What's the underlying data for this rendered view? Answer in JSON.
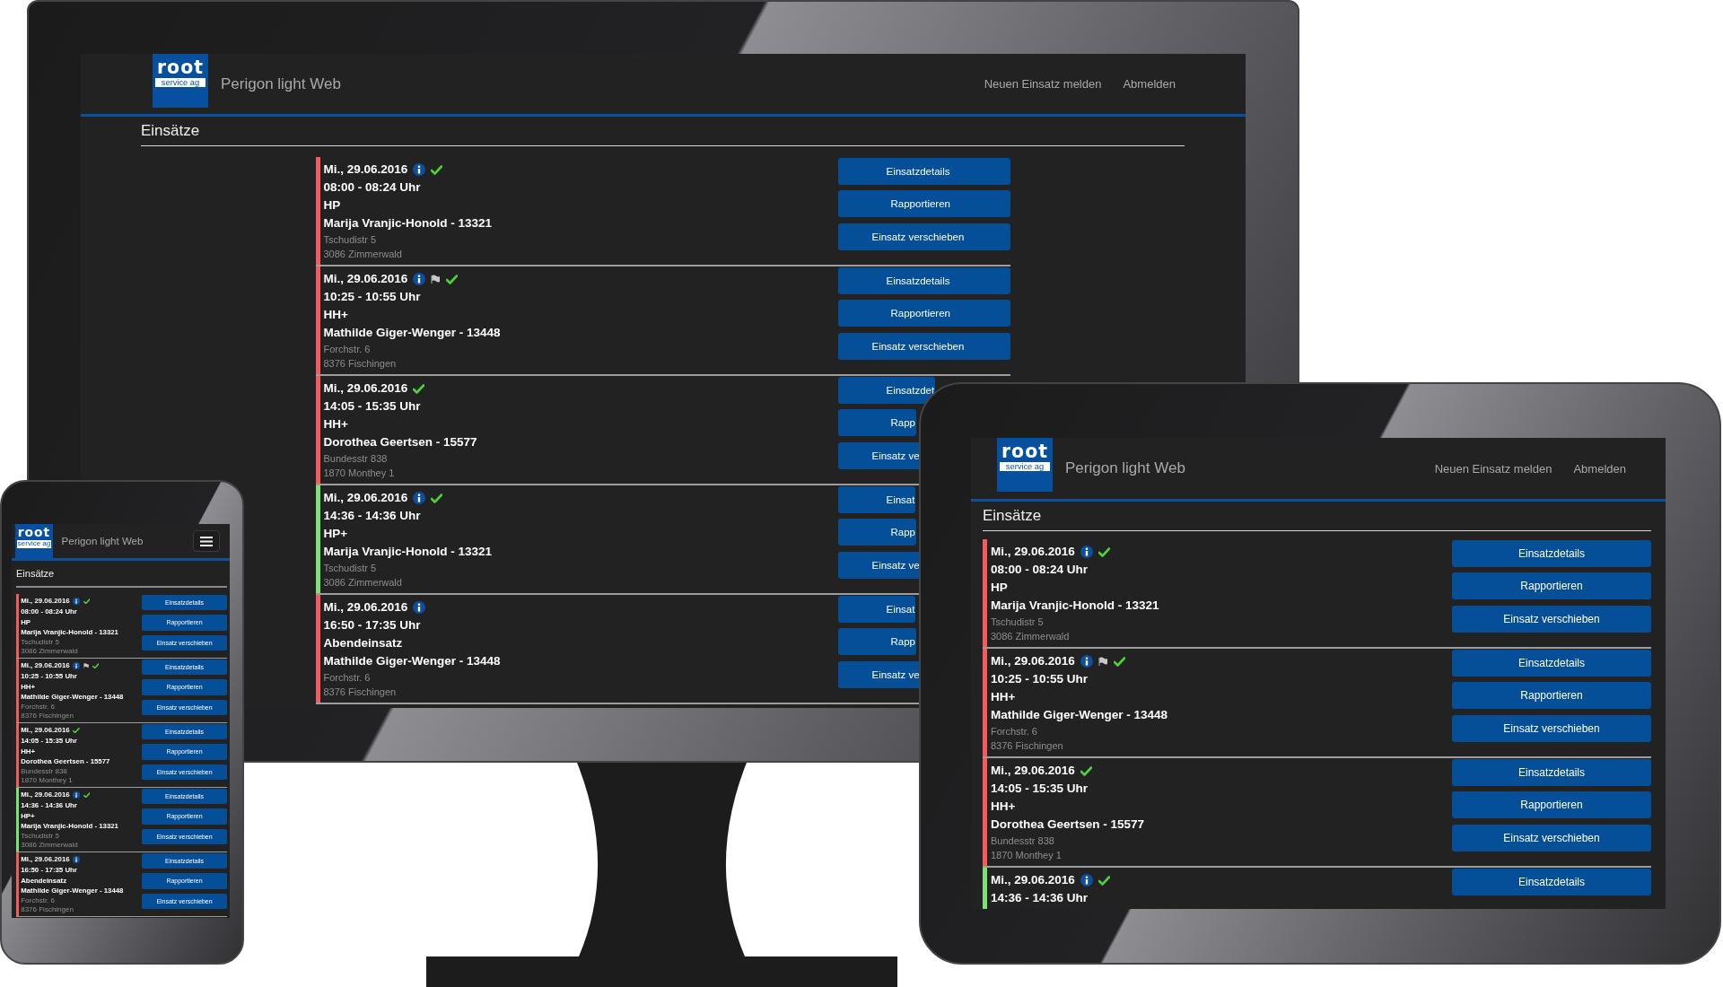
{
  "screens": [
    {
      "kind": "monitor",
      "logo": {
        "word": "root",
        "subtitle": "service ag"
      },
      "app_title": "Perigon light Web",
      "nav": [
        "Neuen Einsatz melden",
        "Abmelden"
      ],
      "page_title": "Einsätze",
      "appointments": [
        {
          "color": "#f25c5c",
          "date": "Mi., 29.06.2016",
          "info": true,
          "done": true,
          "time": "08:00 - 08:24 Uhr",
          "service": "HP",
          "client": "Marija Vranjic-Honold - 13321",
          "street": "Tschudistr 5",
          "city": "3086 Zimmerwald",
          "buttons": [
            "Einsatzdetails",
            "Rapportieren",
            "Einsatz verschieben"
          ]
        },
        {
          "color": "#f25c5c",
          "date": "Mi., 29.06.2016",
          "info": true,
          "note": true,
          "done": true,
          "time": "10:25 - 10:55 Uhr",
          "service": "HH+",
          "client": "Mathilde Giger-Wenger - 13448",
          "street": "Forchstr. 6",
          "city": "8376 Fischingen",
          "buttons": [
            "Einsatzdetails",
            "Rapportieren",
            "Einsatz verschieben"
          ]
        },
        {
          "color": "#f25c5c",
          "date": "Mi., 29.06.2016",
          "done": true,
          "time": "14:05 - 15:35 Uhr",
          "service": "HH+",
          "client": "Dorothea Geertsen - 15577",
          "street": "Bundesstr 838",
          "city": "1870 Monthey 1",
          "buttons": [
            "Einsatzdet",
            "Rapp",
            "Einsatz ve"
          ],
          "buttons_cut": true
        },
        {
          "color": "#7fe07a",
          "date": "Mi., 29.06.2016",
          "info": true,
          "done": true,
          "time": "14:36 - 14:36 Uhr",
          "service": "HP+",
          "client": "Marija Vranjic-Honold - 13321",
          "street": "Tschudistr 5",
          "city": "3086 Zimmerwald",
          "buttons": [
            "Einsat",
            "Rapp",
            "Einsatz ve"
          ],
          "buttons_cut": true
        },
        {
          "color": "#f25c5c",
          "date": "Mi., 29.06.2016",
          "info": true,
          "time": "16:50 - 17:35 Uhr",
          "service": "Abendeinsatz",
          "client": "Mathilde Giger-Wenger - 13448",
          "street": "Forchstr. 6",
          "city": "8376 Fischingen",
          "buttons": [
            "Einsat",
            "Rapp",
            "Einsatz ve"
          ],
          "buttons_cut": true
        }
      ]
    },
    {
      "kind": "tablet",
      "logo": {
        "word": "root",
        "subtitle": "service ag"
      },
      "app_title": "Perigon light Web",
      "nav": [
        "Neuen Einsatz melden",
        "Abmelden"
      ],
      "page_title": "Einsätze",
      "appointments": [
        {
          "color": "#f25c5c",
          "date": "Mi., 29.06.2016",
          "info": true,
          "done": true,
          "time": "08:00 - 08:24 Uhr",
          "service": "HP",
          "client": "Marija Vranjic-Honold - 13321",
          "street": "Tschudistr 5",
          "city": "3086 Zimmerwald",
          "buttons": [
            "Einsatzdetails",
            "Rapportieren",
            "Einsatz verschieben"
          ]
        },
        {
          "color": "#f25c5c",
          "date": "Mi., 29.06.2016",
          "info": true,
          "note": true,
          "done": true,
          "time": "10:25 - 10:55 Uhr",
          "service": "HH+",
          "client": "Mathilde Giger-Wenger - 13448",
          "street": "Forchstr. 6",
          "city": "8376 Fischingen",
          "buttons": [
            "Einsatzdetails",
            "Rapportieren",
            "Einsatz verschieben"
          ]
        },
        {
          "color": "#f25c5c",
          "date": "Mi., 29.06.2016",
          "done": true,
          "time": "14:05 - 15:35 Uhr",
          "service": "HH+",
          "client": "Dorothea Geertsen - 15577",
          "street": "Bundesstr 838",
          "city": "1870 Monthey 1",
          "buttons": [
            "Einsatzdetails",
            "Rapportieren",
            "Einsatz verschieben"
          ]
        },
        {
          "color": "#7fe07a",
          "date": "Mi., 29.06.2016",
          "info": true,
          "done": true,
          "time": "14:36 - 14:36 Uhr",
          "buttons": [
            "Einsatzdetails"
          ]
        }
      ]
    },
    {
      "kind": "phone",
      "logo": {
        "word": "root",
        "subtitle": "service ag"
      },
      "app_title": "Perigon light Web",
      "page_title": "Einsätze",
      "appointments": [
        {
          "color": "#f25c5c",
          "date": "Mi., 29.06.2016",
          "info": true,
          "done": true,
          "time": "08:00 - 08:24 Uhr",
          "service": "HP",
          "client": "Marija Vranjic-Honold - 13321",
          "street": "Tschudistr 5",
          "city": "3086 Zimmerwald",
          "buttons": [
            "Einsatzdetails",
            "Rapportieren",
            "Einsatz verschieben"
          ]
        },
        {
          "color": "#f25c5c",
          "date": "Mi., 29.06.2016",
          "info": true,
          "note": true,
          "done": true,
          "time": "10:25 - 10:55 Uhr",
          "service": "HH+",
          "client": "Mathilde Giger-Wenger - 13448",
          "street": "Forchstr. 6",
          "city": "8376 Fischingen",
          "buttons": [
            "Einsatzdetails",
            "Rapportieren",
            "Einsatz verschieben"
          ]
        },
        {
          "color": "#f25c5c",
          "date": "Mi., 29.06.2016",
          "done": true,
          "time": "14:05 - 15:35 Uhr",
          "service": "HH+",
          "client": "Dorothea Geertsen - 15577",
          "street": "Bundesstr 838",
          "city": "1870 Monthey 1",
          "buttons": [
            "Einsatzdetails",
            "Rapportieren",
            "Einsatz verschieben"
          ]
        },
        {
          "color": "#7fe07a",
          "date": "Mi., 29.06.2016",
          "info": true,
          "done": true,
          "time": "14:36 - 14:36 Uhr",
          "service": "HP+",
          "client": "Marija Vranjic-Honold - 13321",
          "street": "Tschudistr 5",
          "city": "3086 Zimmerwald",
          "buttons": [
            "Einsatzdetails",
            "Rapportieren",
            "Einsatz verschieben"
          ]
        },
        {
          "color": "#f25c5c",
          "date": "Mi., 29.06.2016",
          "info": true,
          "time": "16:50 - 17:35 Uhr",
          "service": "Abendeinsatz",
          "client": "Mathilde Giger-Wenger - 13448",
          "street": "Forchstr. 6",
          "city": "8376 Fischingen",
          "buttons": [
            "Einsatzdetails",
            "Rapportieren",
            "Einsatz verschieben"
          ]
        }
      ]
    }
  ]
}
